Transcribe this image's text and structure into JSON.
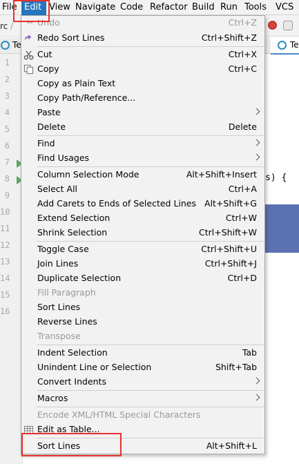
{
  "menubar": {
    "items": [
      "File",
      "Edit",
      "View",
      "Navigate",
      "Code",
      "Refactor",
      "Build",
      "Run",
      "Tools",
      "VCS"
    ],
    "active": "Edit"
  },
  "toolbar": {
    "breadcrumb_fragment": "rc",
    "breadcrumb_sep": "/"
  },
  "tabs": {
    "left_label": "Te",
    "right_label": "Te"
  },
  "editor": {
    "line_numbers": [
      "1",
      "2",
      "3",
      "4",
      "5",
      "6",
      "7",
      "8",
      "9",
      "10",
      "11",
      "12",
      "13",
      "14",
      "15",
      "16"
    ],
    "code_fragment": "s) {"
  },
  "edit_menu": {
    "items": [
      {
        "label": "Undo",
        "shortcut": "Ctrl+Z",
        "disabled": true
      },
      {
        "label": "Redo Sort Lines",
        "shortcut": "Ctrl+Shift+Z"
      },
      {
        "label": "Cut",
        "shortcut": "Ctrl+X"
      },
      {
        "label": "Copy",
        "shortcut": "Ctrl+C"
      },
      {
        "label": "Copy as Plain Text",
        "shortcut": ""
      },
      {
        "label": "Copy Path/Reference...",
        "shortcut": ""
      },
      {
        "label": "Paste",
        "shortcut": "",
        "submenu": true
      },
      {
        "label": "Delete",
        "shortcut": "Delete"
      },
      {
        "label": "Find",
        "shortcut": "",
        "submenu": true
      },
      {
        "label": "Find Usages",
        "shortcut": "",
        "submenu": true
      },
      {
        "label": "Column Selection Mode",
        "shortcut": "Alt+Shift+Insert"
      },
      {
        "label": "Select All",
        "shortcut": "Ctrl+A"
      },
      {
        "label": "Add Carets to Ends of Selected Lines",
        "shortcut": "Alt+Shift+G"
      },
      {
        "label": "Extend Selection",
        "shortcut": "Ctrl+W"
      },
      {
        "label": "Shrink Selection",
        "shortcut": "Ctrl+Shift+W"
      },
      {
        "label": "Toggle Case",
        "shortcut": "Ctrl+Shift+U"
      },
      {
        "label": "Join Lines",
        "shortcut": "Ctrl+Shift+J"
      },
      {
        "label": "Duplicate Selection",
        "shortcut": "Ctrl+D"
      },
      {
        "label": "Fill Paragraph",
        "shortcut": "",
        "disabled": true
      },
      {
        "label": "Sort Lines",
        "shortcut": ""
      },
      {
        "label": "Reverse Lines",
        "shortcut": ""
      },
      {
        "label": "Transpose",
        "shortcut": "",
        "disabled": true
      },
      {
        "label": "Indent Selection",
        "shortcut": "Tab"
      },
      {
        "label": "Unindent Line or Selection",
        "shortcut": "Shift+Tab"
      },
      {
        "label": "Convert Indents",
        "shortcut": "",
        "submenu": true
      },
      {
        "label": "Macros",
        "shortcut": "",
        "submenu": true
      },
      {
        "label": "Encode XML/HTML Special Characters",
        "shortcut": "",
        "disabled": true
      },
      {
        "label": "Edit as Table...",
        "shortcut": ""
      },
      {
        "label": "Sort Lines",
        "shortcut": "Alt+Shift+L"
      }
    ]
  },
  "colors": {
    "menu_bg": "#f2f2f2",
    "active_menu": "#2675bf",
    "highlight_box": "#e8302a",
    "selection": "#5c72b0"
  }
}
